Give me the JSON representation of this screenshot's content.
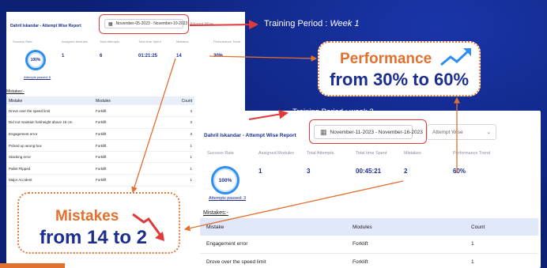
{
  "colors": {
    "background": "#0b1f73",
    "accent_orange": "#e2702e",
    "navy": "#1b2e8f",
    "highlight_red": "#e03a3a",
    "ring_blue": "#2f8ef0"
  },
  "week1": {
    "report_title": "Dahril Iskandar - Attempt Wise Report",
    "date_range": "November-05-2023 - November-10-2023",
    "select_value": "Attempt Wise",
    "stats": {
      "labels": [
        "Success Rate",
        "Assigned Modules",
        "Total Attempts",
        "Total time Spent",
        "Mistakes",
        "Performance Trend"
      ],
      "success_rate": "100%",
      "assigned_modules": "1",
      "total_attempts": "6",
      "total_time": "01:21:25",
      "mistakes": "14",
      "performance": "30%"
    },
    "attempts_passed": "Attempts passed: 6",
    "mistakes_heading": "Mistakes:-",
    "table": {
      "headers": [
        "Mistake",
        "Modules",
        "Count"
      ],
      "rows": [
        [
          "Drove over the speed limit",
          "Forklift",
          "4"
        ],
        [
          "Did not maintain forkheight above 15 cm",
          "Forklift",
          "3"
        ],
        [
          "Engagement error",
          "Forklift",
          "3"
        ],
        [
          "Picked up wrong box",
          "Forklift",
          "1"
        ],
        [
          "Stacking error",
          "Forklift",
          "1"
        ],
        [
          "Pallet Flipped",
          "Forklift",
          "1"
        ],
        [
          "Major Accident",
          "Forklift",
          "1"
        ]
      ]
    }
  },
  "week3": {
    "report_title": "Dahril Iskandar - Attempt Wise Report",
    "date_range": "November-11-2023 - November-16-2023",
    "select_value": "Attempt Wise",
    "stats": {
      "labels": [
        "Success Rate",
        "Assigned Modules",
        "Total Attempts",
        "Total time Spent",
        "Mistakes",
        "Performance Trend"
      ],
      "success_rate": "100%",
      "assigned_modules": "1",
      "total_attempts": "3",
      "total_time": "00:45:21",
      "mistakes": "2",
      "performance": "60%"
    },
    "attempts_passed": "Attempts passed: 3",
    "mistakes_heading": "Mistakes:-",
    "table": {
      "headers": [
        "Mistake",
        "Modules",
        "Count"
      ],
      "rows": [
        [
          "Engagement error",
          "Forklift",
          "1"
        ],
        [
          "Drove over the speed limit",
          "Forklift",
          "1"
        ]
      ]
    }
  },
  "annotations": {
    "period1_prefix": "Training Period : ",
    "period1_week": "Week 1",
    "period3_prefix": "Training Period : ",
    "period3_week": "week 3",
    "performance_line1": "Performance",
    "performance_line2": "from 30% to 60%",
    "mistakes_line1": "Mistakes",
    "mistakes_line2": "from 14 to 2"
  }
}
